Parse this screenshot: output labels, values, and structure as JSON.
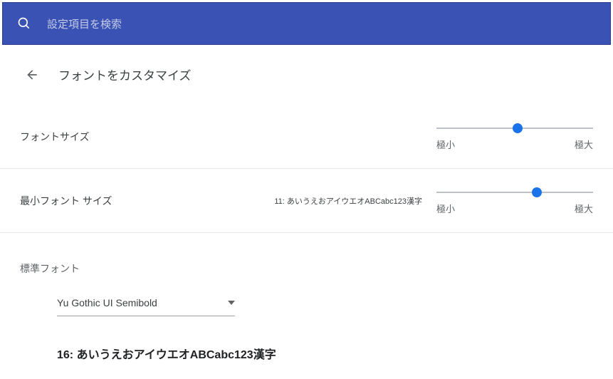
{
  "search": {
    "placeholder": "設定項目を検索"
  },
  "header": {
    "title": "フォントをカスタマイズ"
  },
  "fontSize": {
    "label": "フォントサイズ",
    "min_label": "極小",
    "max_label": "極大",
    "position": 52
  },
  "minFontSize": {
    "label": "最小フォント サイズ",
    "preview": "11: あいうえおアイウエオABCabc123漢字",
    "min_label": "極小",
    "max_label": "極大",
    "position": 64
  },
  "standardFont": {
    "section_label": "標準フォント",
    "selected": "Yu Gothic UI Semibold",
    "preview": "16: あいうえおアイウエオABCabc123漢字"
  }
}
